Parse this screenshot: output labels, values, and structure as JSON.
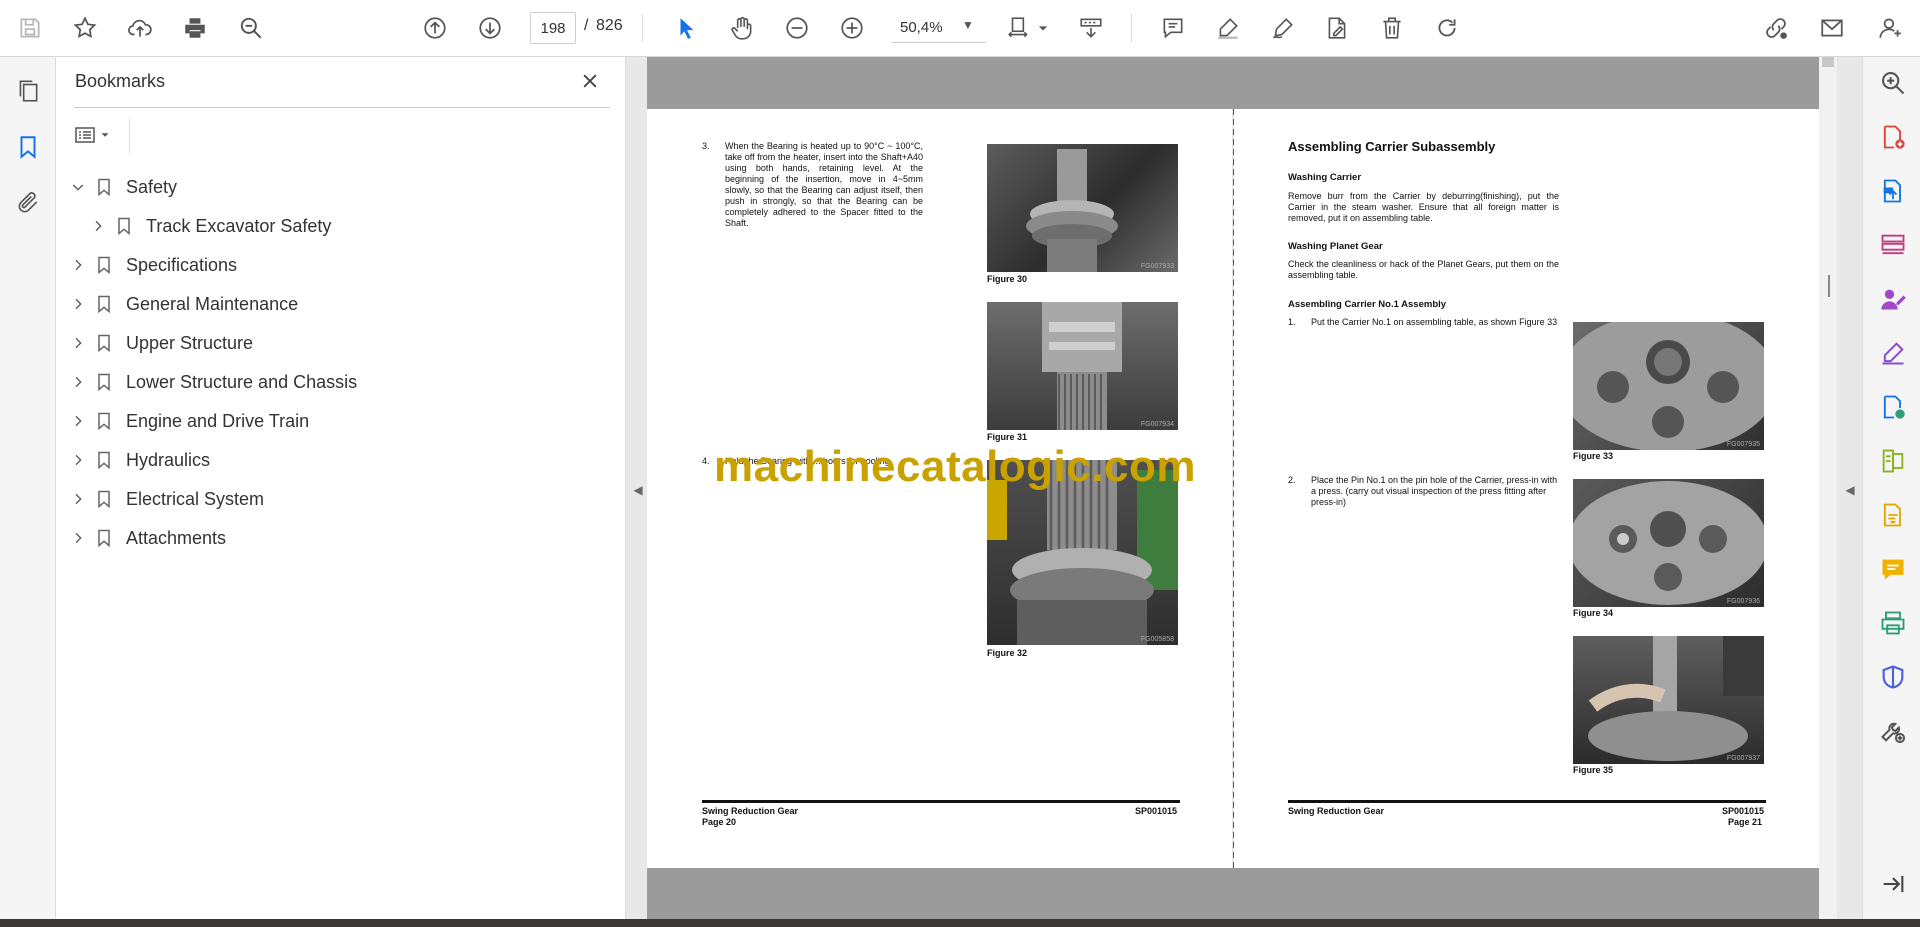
{
  "toolbar": {
    "current_page": "198",
    "page_separator": "/",
    "total_pages": "826",
    "zoom": "50,4%"
  },
  "bookmarks_panel": {
    "title": "Bookmarks",
    "items": [
      {
        "label": "Safety",
        "expanded": true,
        "level": 0
      },
      {
        "label": "Track Excavator Safety",
        "expanded": false,
        "level": 1
      },
      {
        "label": "Specifications",
        "expanded": false,
        "level": 0
      },
      {
        "label": "General Maintenance",
        "expanded": false,
        "level": 0
      },
      {
        "label": "Upper Structure",
        "expanded": false,
        "level": 0
      },
      {
        "label": "Lower Structure and Chassis",
        "expanded": false,
        "level": 0
      },
      {
        "label": "Engine and Drive Train",
        "expanded": false,
        "level": 0
      },
      {
        "label": "Hydraulics",
        "expanded": false,
        "level": 0
      },
      {
        "label": "Electrical System",
        "expanded": false,
        "level": 0
      },
      {
        "label": "Attachments",
        "expanded": false,
        "level": 0
      }
    ]
  },
  "left_page": {
    "step3_num": "3.",
    "step3_text": "When the Bearing is heated up to 90°C ~ 100°C, take off from the heater, insert into the Shaft+A40 using both hands, retaining level. At the beginning of the insertion, move in 4~5mm slowly, so that the Bearing can adjust itself, then push in strongly, so that the Bearing can be completely adhered to the Spacer fitted to the Shaft.",
    "step4_num": "4.",
    "step4_text": "Hold the Bearing with ... hours for cooling",
    "figures": [
      {
        "label": "Figure 30",
        "code": "FG007933"
      },
      {
        "label": "Figure 31",
        "code": "FG007934"
      },
      {
        "label": "Figure 32",
        "code": "FG005858"
      }
    ],
    "footer_title": "Swing Reduction Gear",
    "footer_code": "SP001015",
    "footer_page": "Page 20"
  },
  "right_page": {
    "heading": "Assembling Carrier Subassembly",
    "sub1": "Washing Carrier",
    "text1": "Remove burr from the Carrier by deburring(finishing), put the Carrier in the steam washer. Ensure that all foreign matter is removed, put it on assembling table.",
    "sub2": "Washing Planet Gear",
    "text2": "Check the cleanliness or hack of the Planet Gears, put them on the assembling table.",
    "sub3": "Assembling Carrier No.1 Assembly",
    "step1_num": "1.",
    "step1_text": "Put the Carrier No.1 on assembling table, as shown Figure 33",
    "step2_num": "2.",
    "step2_text": "Place the Pin No.1 on the pin hole of the Carrier, press-in with a press. (carry out visual inspection of the press fitting after press-in)",
    "figures": [
      {
        "label": "Figure 33",
        "code": "FG007935"
      },
      {
        "label": "Figure 34",
        "code": "FG007936"
      },
      {
        "label": "Figure 35",
        "code": "FG007937"
      }
    ],
    "footer_title": "Swing Reduction Gear",
    "footer_code": "SP001015",
    "footer_page": "Page 21"
  },
  "watermark": "machinecatalogic.com",
  "colors": {
    "accent_blue": "#1473e6",
    "icon_gray": "#6b6b6b",
    "watermark": "#c9a100",
    "page_band": "#9b9b9b"
  },
  "icons": {
    "toolbar": [
      "save-icon",
      "bookmark-star-icon",
      "upload-cloud-icon",
      "print-icon",
      "find-zoom-icon",
      "prev-page-icon",
      "next-page-icon",
      "select-arrow-icon",
      "hand-icon",
      "zoom-out-icon",
      "zoom-in-icon",
      "page-fit-icon",
      "scroll-mode-icon",
      "comment-icon",
      "highlight-icon",
      "sign-icon",
      "stamp-icon",
      "delete-icon",
      "redo-icon",
      "share-link-icon",
      "mail-icon",
      "account-icon"
    ],
    "right_rail": [
      "zoom-search-icon",
      "create-pdf-icon",
      "export-pdf-icon",
      "organize-pages-icon",
      "fill-sign-icon",
      "edit-pdf-icon",
      "send-review-icon",
      "compare-icon",
      "scan-ocr-icon",
      "comment-tool-icon",
      "print-production-icon",
      "protect-icon",
      "more-tools-icon",
      "expand-panel-icon"
    ]
  }
}
